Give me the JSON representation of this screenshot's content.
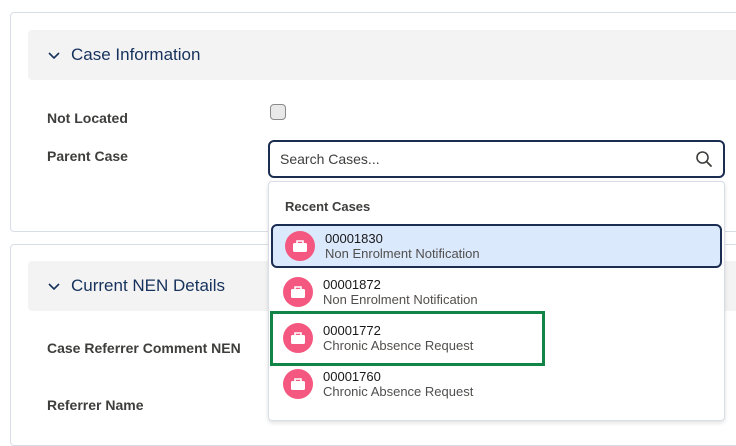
{
  "section_case_info": {
    "title": "Case Information"
  },
  "fields": {
    "not_located_label": "Not Located",
    "parent_case_label": "Parent Case",
    "case_referrer_comment_label": "Case Referrer Comment NEN",
    "referrer_name_label": "Referrer Name"
  },
  "search": {
    "placeholder": "Search Cases..."
  },
  "dropdown": {
    "heading": "Recent Cases",
    "items": [
      {
        "number": "00001830",
        "type": "Non Enrolment Notification"
      },
      {
        "number": "00001872",
        "type": "Non Enrolment Notification"
      },
      {
        "number": "00001772",
        "type": "Chronic Absence Request"
      },
      {
        "number": "00001760",
        "type": "Chronic Absence Request"
      }
    ]
  },
  "section_nen": {
    "title": "Current NEN Details"
  },
  "icons": {
    "chevron": "chevron-down-icon",
    "search": "search-icon",
    "case": "case-briefcase-icon"
  },
  "colors": {
    "case_icon": "#f4577f",
    "focus_border": "#1b2e51",
    "selected_bg": "#dbe9fd",
    "highlight": "#118545"
  }
}
